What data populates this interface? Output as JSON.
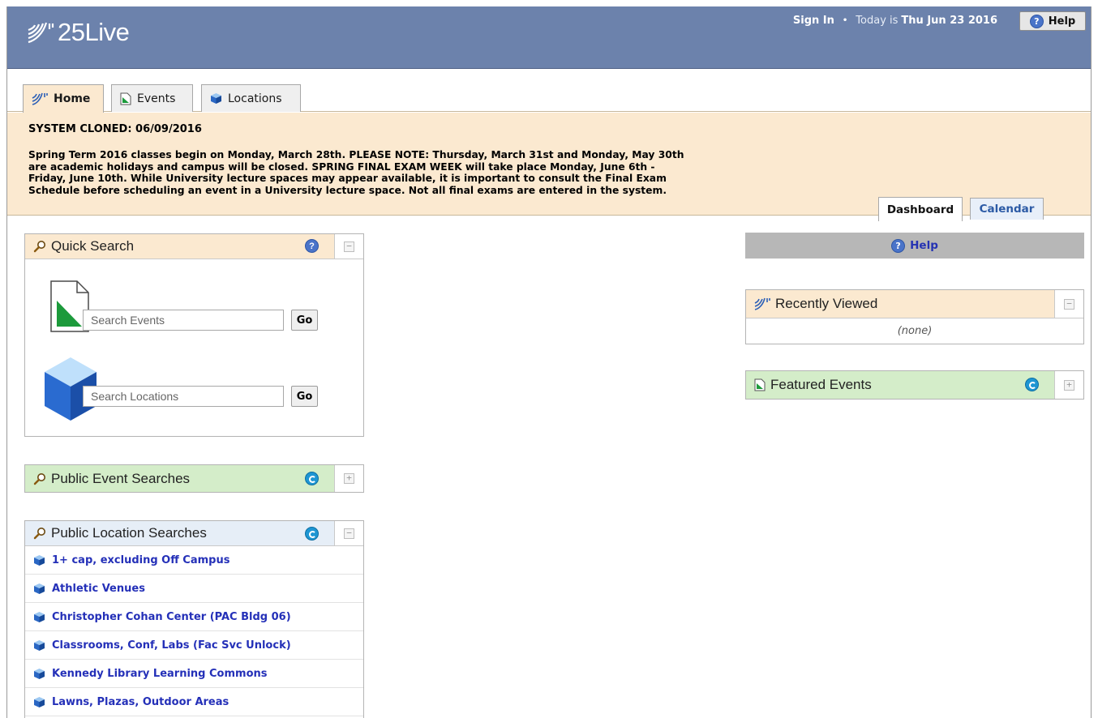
{
  "app": {
    "logo_text": "25Live"
  },
  "header": {
    "sign_in": "Sign In",
    "separator": "•",
    "today_prefix": "Today is",
    "today_date": "Thu Jun 23 2016",
    "help_label": "Help"
  },
  "tabs": [
    {
      "label": "Home",
      "icon": "home-swoosh-icon",
      "active": true
    },
    {
      "label": "Events",
      "icon": "event-document-icon",
      "active": false
    },
    {
      "label": "Locations",
      "icon": "location-cube-icon",
      "active": false
    }
  ],
  "announcement": {
    "title": "SYSTEM CLONED: 06/09/2016",
    "lines": [
      "Spring Term 2016 classes begin on Monday, March 28th. PLEASE NOTE: Thursday, March 31st and Monday, May 30th",
      "are academic holidays and campus will be closed. SPRING FINAL EXAM WEEK will take place Monday, June 6th -",
      "Friday, June 10th. While University lecture spaces may appear available, it is important to consult the Final Exam",
      "Schedule before scheduling an event in a University lecture space. Not all final exams are entered in the system."
    ]
  },
  "view_tabs": {
    "dashboard": "Dashboard",
    "calendar": "Calendar"
  },
  "quick_search": {
    "title": "Quick Search",
    "events_placeholder": "Search Events",
    "locations_placeholder": "Search Locations",
    "go_label": "Go"
  },
  "public_event_searches": {
    "title": "Public Event Searches"
  },
  "public_location_searches": {
    "title": "Public Location Searches",
    "items": [
      "1+ cap, excluding Off Campus",
      "Athletic Venues",
      "Christopher Cohan Center (PAC Bldg 06)",
      "Classrooms, Conf, Labs (Fac Svc Unlock)",
      "Kennedy Library Learning Commons",
      "Lawns, Plazas, Outdoor Areas"
    ]
  },
  "right": {
    "help_label": "Help",
    "recently_viewed": {
      "title": "Recently Viewed",
      "empty": "(none)"
    },
    "featured_events": {
      "title": "Featured Events"
    }
  },
  "colors": {
    "header_bg": "#6c82ac",
    "announce_bg": "#fbe9d0",
    "green_head": "#d4edc9",
    "blue_head": "#e6eef7",
    "link": "#2430b8"
  }
}
